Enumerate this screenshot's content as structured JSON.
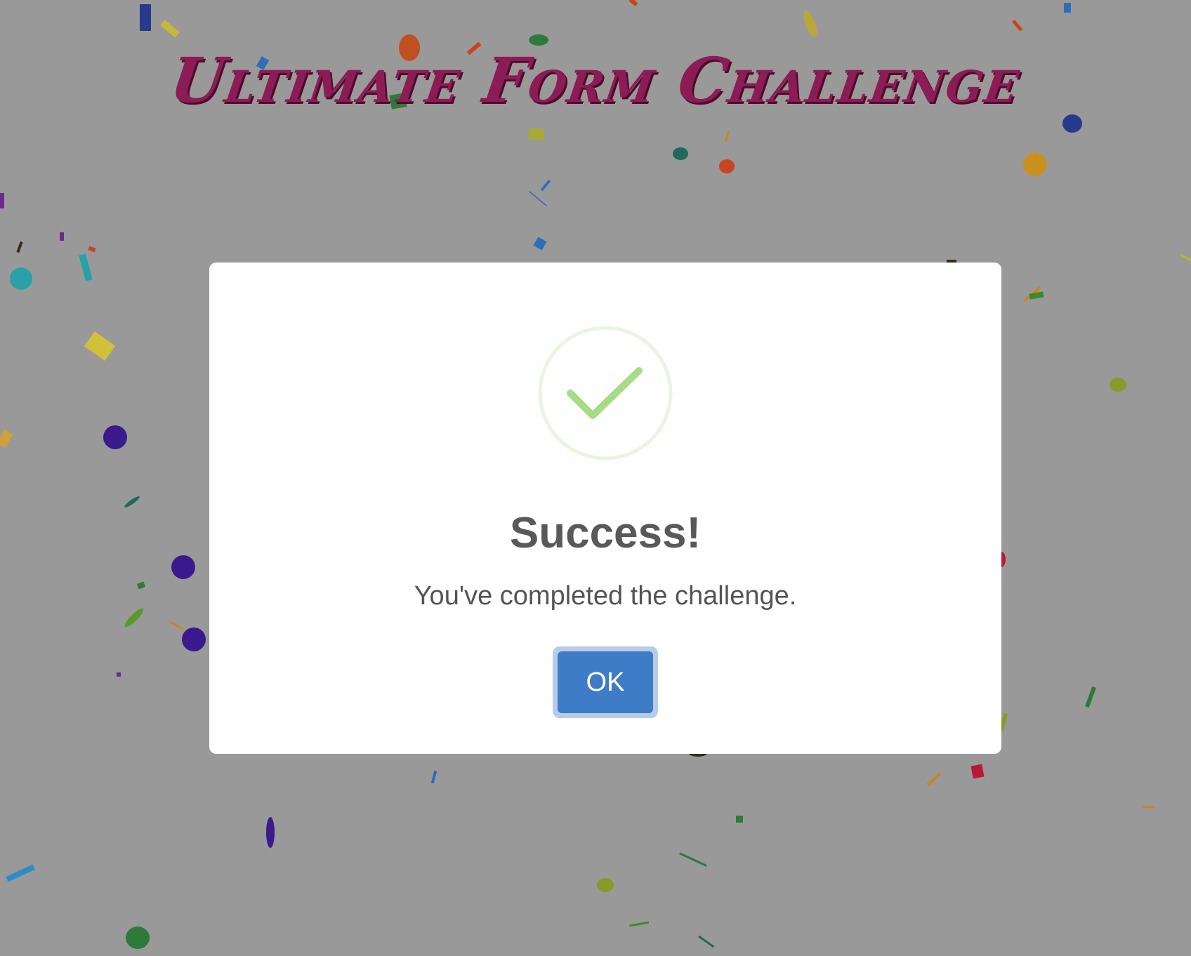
{
  "page": {
    "title": "Ultimate Form Challenge"
  },
  "modal": {
    "icon": "success-checkmark-icon",
    "title": "Success!",
    "message": "You've completed the challenge.",
    "confirm_label": "OK"
  },
  "colors": {
    "backdrop": "#999999",
    "title": "#8c1c55",
    "confirm_button": "#3e7cc7",
    "check": "#a5dc86",
    "check_ring": "#e8f5e0"
  },
  "decor": {
    "confetti": "confetti-pieces"
  }
}
